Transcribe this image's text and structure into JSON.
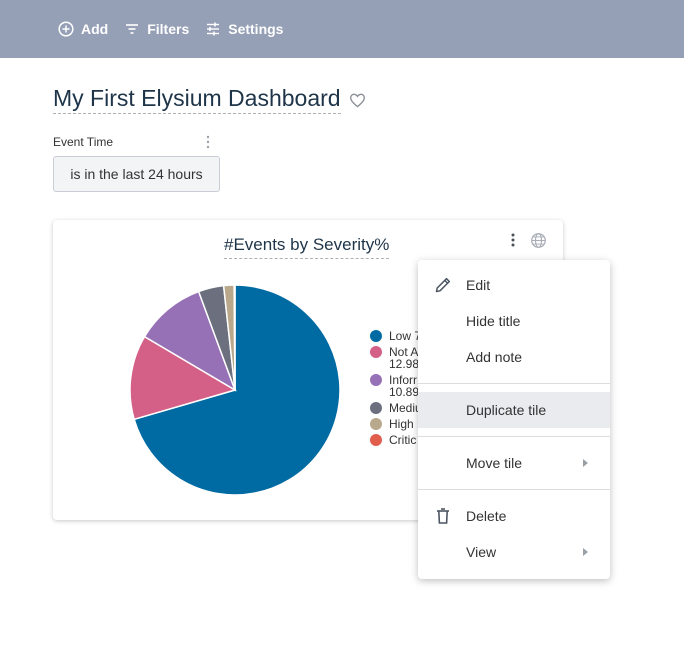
{
  "toolbar": {
    "add_label": "Add",
    "filters_label": "Filters",
    "settings_label": "Settings"
  },
  "dashboard": {
    "title": "My First Elysium Dashboard"
  },
  "filter": {
    "label": "Event Time",
    "value": "is in the last 24 hours"
  },
  "tile": {
    "title": "#Events by Severity%",
    "legend": [
      {
        "line1": "Low 7",
        "line2": ""
      },
      {
        "line1": "Not A",
        "line2": "12.98"
      },
      {
        "line1": "Inforr",
        "line2": "10.89"
      },
      {
        "line1": "Mediu",
        "line2": ""
      },
      {
        "line1": "High",
        "line2": ""
      },
      {
        "line1": "Critic",
        "line2": ""
      }
    ]
  },
  "menu": {
    "edit": "Edit",
    "hide_title": "Hide title",
    "add_note": "Add note",
    "duplicate_tile": "Duplicate tile",
    "move_tile": "Move tile",
    "delete": "Delete",
    "view": "View"
  },
  "chart_data": {
    "type": "pie",
    "categories": [
      "Low",
      "Not Assigned",
      "Informational",
      "Medium",
      "High",
      "Critical"
    ],
    "values": [
      70.5,
      12.98,
      10.89,
      3.9,
      1.6,
      0.13
    ],
    "colors": [
      "#006aa3",
      "#d45f87",
      "#9671b6",
      "#6c6f7d",
      "#b9a88c",
      "#e05e4b"
    ]
  }
}
